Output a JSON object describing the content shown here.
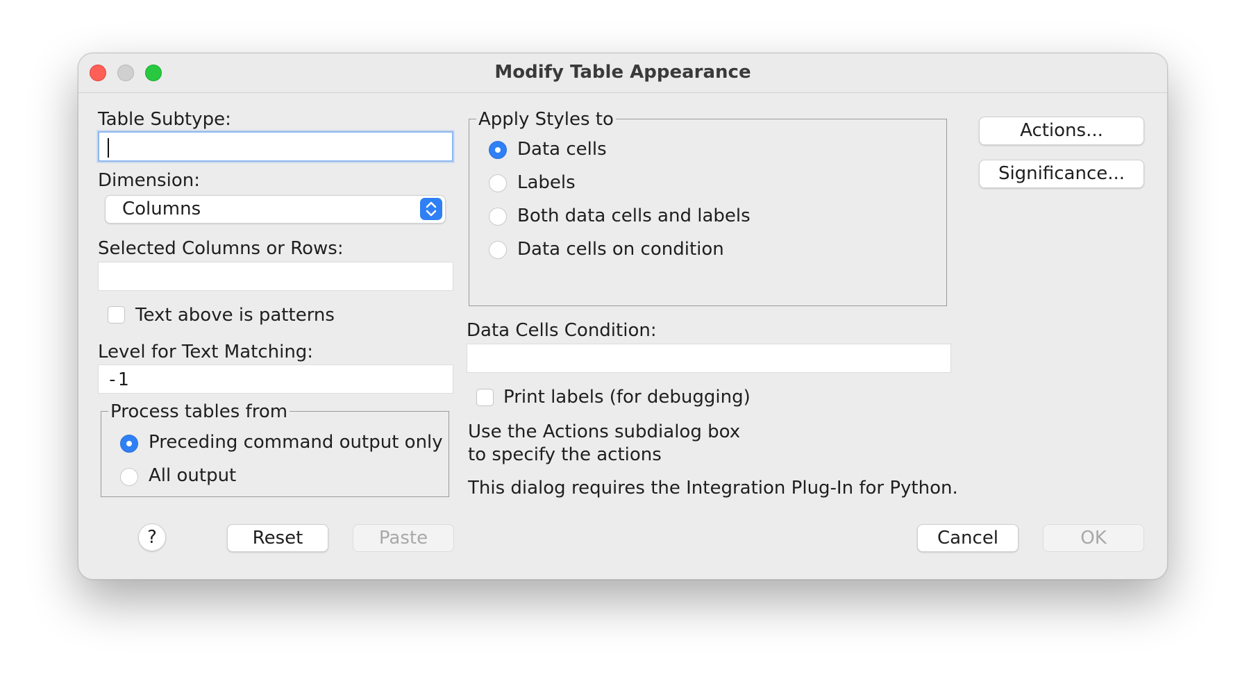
{
  "window": {
    "title": "Modify Table Appearance"
  },
  "left": {
    "table_subtype_label": "Table Subtype:",
    "table_subtype_value": "",
    "dimension_label": "Dimension:",
    "dimension_value": "Columns",
    "selected_label": "Selected Columns or Rows:",
    "selected_value": "",
    "patterns_checkbox": "Text above is patterns",
    "patterns_checked": false,
    "level_label": "Level for Text Matching:",
    "level_value": "-1",
    "process_group": {
      "legend": "Process tables from",
      "options": [
        {
          "label": "Preceding command output only",
          "selected": true
        },
        {
          "label": "All output",
          "selected": false
        }
      ]
    }
  },
  "middle": {
    "apply_group": {
      "legend": "Apply Styles to",
      "options": [
        {
          "label": "Data cells",
          "selected": true
        },
        {
          "label": "Labels",
          "selected": false
        },
        {
          "label": "Both data cells and labels",
          "selected": false
        },
        {
          "label": "Data cells on condition",
          "selected": false
        }
      ]
    },
    "condition_label": "Data Cells Condition:",
    "condition_value": "",
    "print_labels_checkbox": "Print labels (for debugging)",
    "print_labels_checked": false,
    "info_line1": "Use the Actions subdialog box",
    "info_line2": "to specify the actions",
    "info_line3": "This dialog requires the Integration Plug-In for Python."
  },
  "right": {
    "actions_button": "Actions...",
    "significance_button": "Significance..."
  },
  "footer": {
    "help_label": "?",
    "reset_button": "Reset",
    "paste_button": "Paste",
    "cancel_button": "Cancel",
    "ok_button": "OK"
  },
  "colors": {
    "accent": "#2f7ff5",
    "window_bg": "#ececec",
    "close": "#fe5f57",
    "maximize": "#28c840"
  }
}
